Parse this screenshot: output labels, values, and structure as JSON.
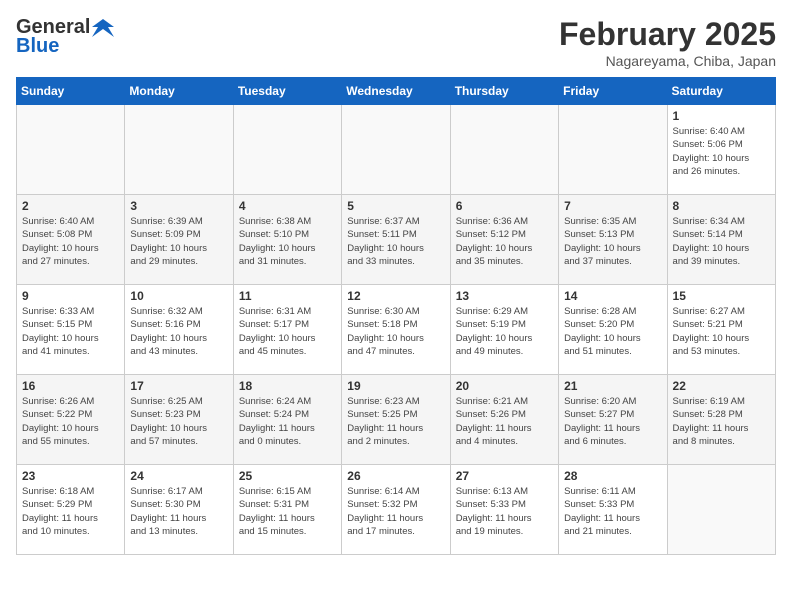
{
  "header": {
    "logo_general": "General",
    "logo_blue": "Blue",
    "title": "February 2025",
    "subtitle": "Nagareyama, Chiba, Japan"
  },
  "days_of_week": [
    "Sunday",
    "Monday",
    "Tuesday",
    "Wednesday",
    "Thursday",
    "Friday",
    "Saturday"
  ],
  "weeks": [
    {
      "days": [
        {
          "num": "",
          "info": ""
        },
        {
          "num": "",
          "info": ""
        },
        {
          "num": "",
          "info": ""
        },
        {
          "num": "",
          "info": ""
        },
        {
          "num": "",
          "info": ""
        },
        {
          "num": "",
          "info": ""
        },
        {
          "num": "1",
          "info": "Sunrise: 6:40 AM\nSunset: 5:06 PM\nDaylight: 10 hours\nand 26 minutes."
        }
      ]
    },
    {
      "days": [
        {
          "num": "2",
          "info": "Sunrise: 6:40 AM\nSunset: 5:08 PM\nDaylight: 10 hours\nand 27 minutes."
        },
        {
          "num": "3",
          "info": "Sunrise: 6:39 AM\nSunset: 5:09 PM\nDaylight: 10 hours\nand 29 minutes."
        },
        {
          "num": "4",
          "info": "Sunrise: 6:38 AM\nSunset: 5:10 PM\nDaylight: 10 hours\nand 31 minutes."
        },
        {
          "num": "5",
          "info": "Sunrise: 6:37 AM\nSunset: 5:11 PM\nDaylight: 10 hours\nand 33 minutes."
        },
        {
          "num": "6",
          "info": "Sunrise: 6:36 AM\nSunset: 5:12 PM\nDaylight: 10 hours\nand 35 minutes."
        },
        {
          "num": "7",
          "info": "Sunrise: 6:35 AM\nSunset: 5:13 PM\nDaylight: 10 hours\nand 37 minutes."
        },
        {
          "num": "8",
          "info": "Sunrise: 6:34 AM\nSunset: 5:14 PM\nDaylight: 10 hours\nand 39 minutes."
        }
      ]
    },
    {
      "days": [
        {
          "num": "9",
          "info": "Sunrise: 6:33 AM\nSunset: 5:15 PM\nDaylight: 10 hours\nand 41 minutes."
        },
        {
          "num": "10",
          "info": "Sunrise: 6:32 AM\nSunset: 5:16 PM\nDaylight: 10 hours\nand 43 minutes."
        },
        {
          "num": "11",
          "info": "Sunrise: 6:31 AM\nSunset: 5:17 PM\nDaylight: 10 hours\nand 45 minutes."
        },
        {
          "num": "12",
          "info": "Sunrise: 6:30 AM\nSunset: 5:18 PM\nDaylight: 10 hours\nand 47 minutes."
        },
        {
          "num": "13",
          "info": "Sunrise: 6:29 AM\nSunset: 5:19 PM\nDaylight: 10 hours\nand 49 minutes."
        },
        {
          "num": "14",
          "info": "Sunrise: 6:28 AM\nSunset: 5:20 PM\nDaylight: 10 hours\nand 51 minutes."
        },
        {
          "num": "15",
          "info": "Sunrise: 6:27 AM\nSunset: 5:21 PM\nDaylight: 10 hours\nand 53 minutes."
        }
      ]
    },
    {
      "days": [
        {
          "num": "16",
          "info": "Sunrise: 6:26 AM\nSunset: 5:22 PM\nDaylight: 10 hours\nand 55 minutes."
        },
        {
          "num": "17",
          "info": "Sunrise: 6:25 AM\nSunset: 5:23 PM\nDaylight: 10 hours\nand 57 minutes."
        },
        {
          "num": "18",
          "info": "Sunrise: 6:24 AM\nSunset: 5:24 PM\nDaylight: 11 hours\nand 0 minutes."
        },
        {
          "num": "19",
          "info": "Sunrise: 6:23 AM\nSunset: 5:25 PM\nDaylight: 11 hours\nand 2 minutes."
        },
        {
          "num": "20",
          "info": "Sunrise: 6:21 AM\nSunset: 5:26 PM\nDaylight: 11 hours\nand 4 minutes."
        },
        {
          "num": "21",
          "info": "Sunrise: 6:20 AM\nSunset: 5:27 PM\nDaylight: 11 hours\nand 6 minutes."
        },
        {
          "num": "22",
          "info": "Sunrise: 6:19 AM\nSunset: 5:28 PM\nDaylight: 11 hours\nand 8 minutes."
        }
      ]
    },
    {
      "days": [
        {
          "num": "23",
          "info": "Sunrise: 6:18 AM\nSunset: 5:29 PM\nDaylight: 11 hours\nand 10 minutes."
        },
        {
          "num": "24",
          "info": "Sunrise: 6:17 AM\nSunset: 5:30 PM\nDaylight: 11 hours\nand 13 minutes."
        },
        {
          "num": "25",
          "info": "Sunrise: 6:15 AM\nSunset: 5:31 PM\nDaylight: 11 hours\nand 15 minutes."
        },
        {
          "num": "26",
          "info": "Sunrise: 6:14 AM\nSunset: 5:32 PM\nDaylight: 11 hours\nand 17 minutes."
        },
        {
          "num": "27",
          "info": "Sunrise: 6:13 AM\nSunset: 5:33 PM\nDaylight: 11 hours\nand 19 minutes."
        },
        {
          "num": "28",
          "info": "Sunrise: 6:11 AM\nSunset: 5:33 PM\nDaylight: 11 hours\nand 21 minutes."
        },
        {
          "num": "",
          "info": ""
        }
      ]
    }
  ]
}
